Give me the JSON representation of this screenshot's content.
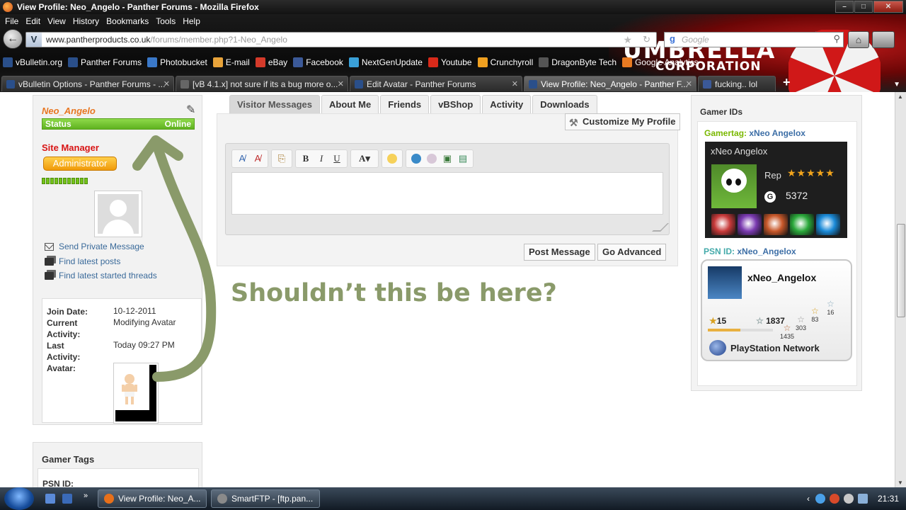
{
  "window": {
    "title": "View Profile: Neo_Angelo - Panther Forums - Mozilla Firefox"
  },
  "menu": [
    "File",
    "Edit",
    "View",
    "History",
    "Bookmarks",
    "Tools",
    "Help"
  ],
  "nav": {
    "url_domain": "www.pantherproducts.co.uk",
    "url_path": "/forums/member.php?1-Neo_Angelo",
    "search_placeholder": "Google",
    "site_badge": "V"
  },
  "persona": {
    "brand": "UMBRELLA",
    "brand_sub": "CORPORATION"
  },
  "bookmarks": [
    {
      "label": "vBulletin.org",
      "color": "#2a4f8a"
    },
    {
      "label": "Panther Forums",
      "color": "#2a4f8a"
    },
    {
      "label": "Photobucket",
      "color": "#3a78c8"
    },
    {
      "label": "E-mail",
      "color": "#e8a33a"
    },
    {
      "label": "eBay",
      "color": "#d43a2a"
    },
    {
      "label": "Facebook",
      "color": "#3b5998"
    },
    {
      "label": "NextGenUpdate",
      "color": "#3aa0d8"
    },
    {
      "label": "Youtube",
      "color": "#d82a1a"
    },
    {
      "label": "Crunchyroll",
      "color": "#f0a020"
    },
    {
      "label": "DragonByte Tech",
      "color": "#555555"
    },
    {
      "label": "Google Analytics",
      "color": "#e87a22"
    }
  ],
  "tabs": [
    {
      "label": "vBulletin Options - Panther Forums - ...",
      "fav": "#2a4f8a"
    },
    {
      "label": "[vB 4.1.x] not sure if its a bug more o...",
      "fav": "#666666"
    },
    {
      "label": "Edit Avatar - Panther Forums",
      "fav": "#2a4f8a"
    },
    {
      "label": "View Profile: Neo_Angelo - Panther F...",
      "fav": "#2a4f8a"
    },
    {
      "label": "fucking.. lol",
      "fav": "#3b5998"
    }
  ],
  "profile": {
    "username": "Neo_Angelo",
    "status_label": "Status",
    "status_value": "Online",
    "usertitle": "Site Manager",
    "badge": "Administrator",
    "reputation_pips": 11,
    "links": {
      "pm": "Send Private Message",
      "posts": "Find latest posts",
      "threads": "Find latest started threads"
    },
    "info": {
      "join_label": "Join Date:",
      "join_value": "10-12-2011",
      "current_label_1": "Current",
      "current_label_2": "Activity:",
      "current_value": "Modifying Avatar",
      "last_label_1": "Last",
      "last_label_2": "Activity:",
      "last_value": "Today 09:27 PM",
      "avatar_label": "Avatar:"
    },
    "gamer_tags_title": "Gamer Tags",
    "psn_label": "PSN ID:"
  },
  "profile_tabs": [
    "Visitor Messages",
    "About Me",
    "Friends",
    "vBShop",
    "Activity",
    "Downloads"
  ],
  "customize_label": "Customize My Profile",
  "editor": {
    "post_label": "Post Message",
    "advanced_label": "Go Advanced",
    "color_label": "A"
  },
  "annotation": "Shouldn’t this be here?",
  "gamer_ids": {
    "title": "Gamer IDs",
    "gamertag_label": "Gamertag:",
    "gamertag_name": "xNeo Angelox",
    "card_name": "xNeo Angelox",
    "rep_label": "Rep",
    "rep_stars": "★★★★★",
    "gamerscore_icon": "G",
    "gamerscore": "5372",
    "game_colors": [
      "#c83a3a",
      "#7a3ab0",
      "#c8582a",
      "#2aa83a",
      "#1a8ad8"
    ],
    "psn_label": "PSN ID:",
    "psn_name": "xNeo_Angelox",
    "psn_card_name": "xNeo_Angelox",
    "psn_level": "15",
    "psn_total": "1837",
    "platinum": "16",
    "gold": "83",
    "silver": "303",
    "bronze": "1435",
    "psn_logo_text": "PlayStation Network",
    "psn_level_progress": 0.5
  },
  "taskbar": {
    "tasks": [
      {
        "label": "View Profile: Neo_A...",
        "color": "#e8701a"
      },
      {
        "label": "SmartFTP - [ftp.pan...",
        "color": "#8a8a8a"
      }
    ],
    "time": "21:31"
  }
}
